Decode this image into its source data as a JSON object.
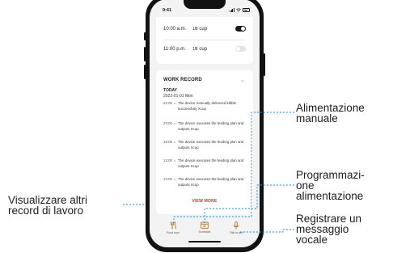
{
  "status_bar": {
    "time": "9:41"
  },
  "schedule": {
    "rows": [
      {
        "time": "10:00 a.m.",
        "fraction": "1/8",
        "unit": "cup",
        "enabled": true
      },
      {
        "time": "11:00 p.m.",
        "fraction": "1/8",
        "unit": "cup",
        "enabled": false
      }
    ]
  },
  "work_record": {
    "title": "WORK RECORD",
    "section": "TODAY",
    "date": "2022-01-01 Mon",
    "records": [
      {
        "time": "22:00",
        "text": "The device manually delivered kibble successfully Xcup"
      },
      {
        "time": "20:00",
        "text": "The device executes the feeding plan and outputs Xcup"
      },
      {
        "time": "16:00",
        "text": "The device executes the feeding plan and outputs Xcup"
      },
      {
        "time": "12:00",
        "text": "The device executes the feeding plan and outputs Xcup"
      },
      {
        "time": "10:00",
        "text": "The device executes the feeding plan and outputs Xcup"
      }
    ],
    "view_more": "VIEW MORE"
  },
  "tabbar": {
    "tabs": [
      {
        "label": "Food bow",
        "icon": "food-bowl-icon"
      },
      {
        "label": "Schedule",
        "icon": "schedule-icon"
      },
      {
        "label": "Talk to pet",
        "icon": "microphone-icon"
      }
    ]
  },
  "callouts": {
    "manual_feeding": [
      "Alimentazione",
      "manuale"
    ],
    "feeding_schedule": [
      "Programmazi-",
      "one",
      "alimentazione"
    ],
    "voice_message": [
      "Registrare un",
      "messaggio",
      "vocale"
    ],
    "view_more_records": [
      "Visualizzare altri",
      "record di lavoro"
    ]
  },
  "colors": {
    "callout_line": "#2a8fd0",
    "accent": "#c23a2f",
    "phone_frame": "#121212"
  }
}
